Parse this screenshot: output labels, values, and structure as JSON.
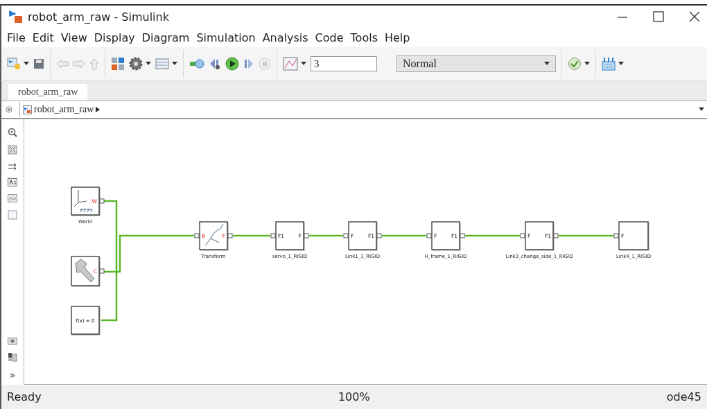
{
  "window": {
    "title": "robot_arm_raw - Simulink"
  },
  "menu": [
    "File",
    "Edit",
    "View",
    "Display",
    "Diagram",
    "Simulation",
    "Analysis",
    "Code",
    "Tools",
    "Help"
  ],
  "toolbar": {
    "stop_time": "3",
    "simulation_mode": "Normal"
  },
  "tabs": [
    {
      "label": "robot_arm_raw",
      "selected": true
    }
  ],
  "breadcrumb": {
    "path": "robot_arm_raw"
  },
  "palette": {
    "more": "»"
  },
  "blocks": [
    {
      "kind": "world",
      "label": "World",
      "out_port": "W"
    },
    {
      "kind": "solver",
      "out_port": "C"
    },
    {
      "kind": "equation",
      "text": "f(x) = 0"
    },
    {
      "kind": "transform",
      "label": "Transform",
      "in_port": "B",
      "out_port": "F"
    },
    {
      "kind": "solid",
      "label": "servo_1_RIGID",
      "in_port": "F1",
      "out_port": "F"
    },
    {
      "kind": "solid",
      "label": "Link1_1_RIGID",
      "in_port": "F",
      "out_port": "F1"
    },
    {
      "kind": "solid",
      "label": "H_frame_1_RIGID",
      "in_port": "F",
      "out_port": "F1"
    },
    {
      "kind": "solid",
      "label": "Link3_change_side_1_RIGID",
      "in_port": "F",
      "out_port": "F1"
    },
    {
      "kind": "solid",
      "label": "Link4_1_RIGID",
      "in_port": "F"
    }
  ],
  "status_bar": {
    "state": "Ready",
    "zoom": "100%",
    "solver": "ode45"
  }
}
